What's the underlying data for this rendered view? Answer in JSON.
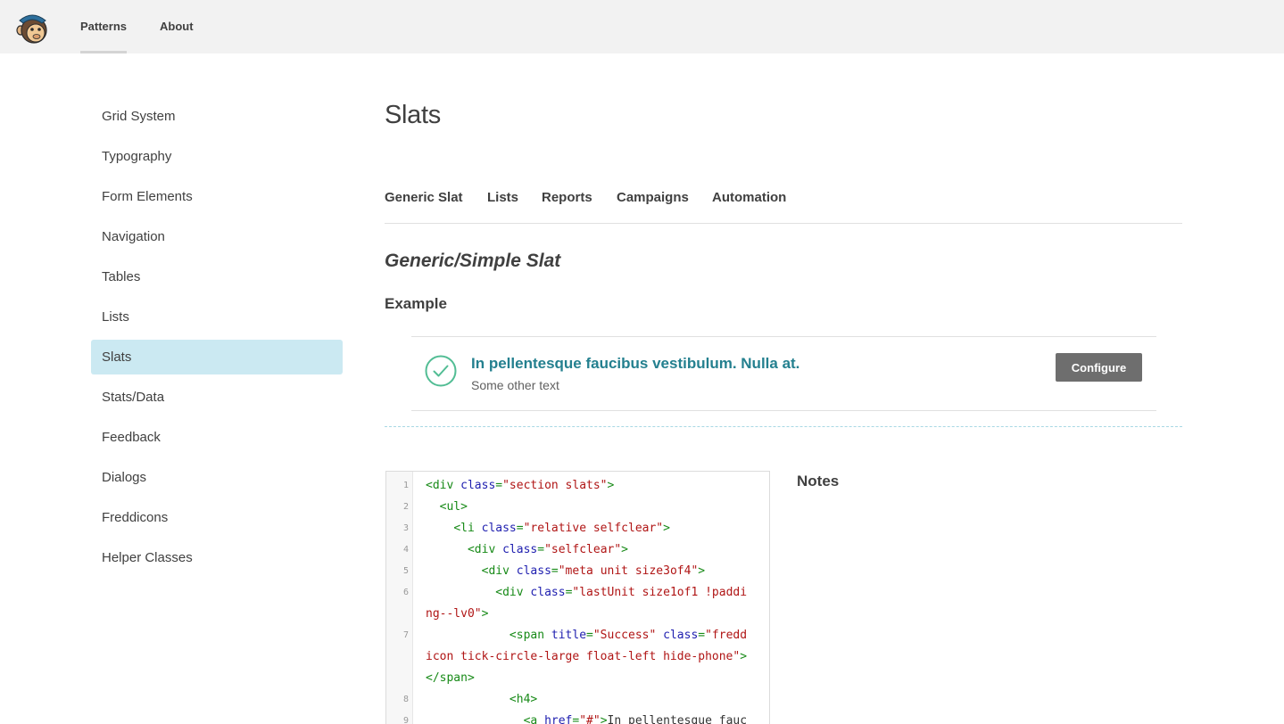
{
  "header": {
    "logo_icon": "monkey-logo-icon",
    "nav": [
      {
        "label": "Patterns",
        "active": true
      },
      {
        "label": "About",
        "active": false
      }
    ]
  },
  "sidebar": {
    "items": [
      {
        "label": "Grid System"
      },
      {
        "label": "Typography"
      },
      {
        "label": "Form Elements"
      },
      {
        "label": "Navigation"
      },
      {
        "label": "Tables"
      },
      {
        "label": "Lists"
      },
      {
        "label": "Slats",
        "active": true
      },
      {
        "label": "Stats/Data"
      },
      {
        "label": "Feedback"
      },
      {
        "label": "Dialogs"
      },
      {
        "label": "Freddicons"
      },
      {
        "label": "Helper Classes"
      }
    ]
  },
  "main": {
    "title": "Slats",
    "tabs": [
      {
        "label": "Generic Slat"
      },
      {
        "label": "Lists"
      },
      {
        "label": "Reports"
      },
      {
        "label": "Campaigns"
      },
      {
        "label": "Automation"
      }
    ],
    "section_title": "Generic/Simple Slat",
    "example_label": "Example",
    "slat": {
      "icon": "tick-circle-icon",
      "title": "In pellentesque faucibus vestibulum. Nulla at.",
      "subtitle": "Some other text",
      "button_label": "Configure"
    },
    "code": {
      "line_numbers": [
        "1",
        "2",
        "3",
        "4",
        "5",
        "6",
        "7",
        "8",
        "9"
      ],
      "lines": [
        [
          [
            "t",
            "<div "
          ],
          [
            "a",
            "class"
          ],
          [
            "t",
            "="
          ],
          [
            "v",
            "\"section slats\""
          ],
          [
            "t",
            ">"
          ]
        ],
        [
          [
            "t",
            "  <ul>"
          ]
        ],
        [
          [
            "t",
            "    <li "
          ],
          [
            "a",
            "class"
          ],
          [
            "t",
            "="
          ],
          [
            "v",
            "\"relative selfclear\""
          ],
          [
            "t",
            ">"
          ]
        ],
        [
          [
            "t",
            "      <div "
          ],
          [
            "a",
            "class"
          ],
          [
            "t",
            "="
          ],
          [
            "v",
            "\"selfclear\""
          ],
          [
            "t",
            ">"
          ]
        ],
        [
          [
            "t",
            "        <div "
          ],
          [
            "a",
            "class"
          ],
          [
            "t",
            "="
          ],
          [
            "v",
            "\"meta unit size3of4\""
          ],
          [
            "t",
            ">"
          ]
        ],
        [
          [
            "t",
            "          <div "
          ],
          [
            "a",
            "class"
          ],
          [
            "t",
            "="
          ],
          [
            "v",
            "\"lastUnit size1of1 !padding--lv0\""
          ],
          [
            "t",
            ">"
          ]
        ],
        [
          [
            "t",
            "            <span "
          ],
          [
            "a",
            "title"
          ],
          [
            "t",
            "="
          ],
          [
            "v",
            "\"Success\" "
          ],
          [
            "a",
            "class"
          ],
          [
            "t",
            "="
          ],
          [
            "v",
            "\"freddicon tick-circle-large float-left hide-phone\""
          ],
          [
            "t",
            "></span>"
          ]
        ],
        [
          [
            "t",
            "            <h4>"
          ]
        ],
        [
          [
            "t",
            "              <a "
          ],
          [
            "a",
            "href"
          ],
          [
            "t",
            "="
          ],
          [
            "v",
            "\"#\""
          ],
          [
            "t",
            ">"
          ],
          [
            "p",
            "In pellentesque fauci"
          ]
        ]
      ]
    },
    "notes_title": "Notes"
  },
  "colors": {
    "accent_link": "#24808f",
    "sidebar_active_bg": "#cbe9f2",
    "button_bg": "#6e6e6e",
    "topbar_bg": "#f2f2f2"
  }
}
